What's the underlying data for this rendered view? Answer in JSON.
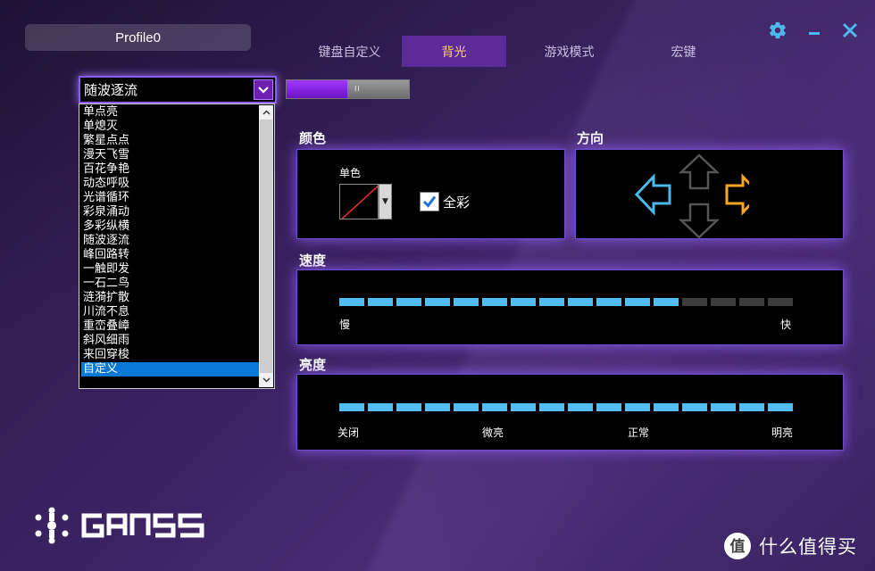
{
  "profile": {
    "name": "Profile0"
  },
  "tabs": [
    {
      "label": "键盘自定义",
      "active": false
    },
    {
      "label": "背光",
      "active": true
    },
    {
      "label": "游戏模式",
      "active": false
    },
    {
      "label": "宏键",
      "active": false
    }
  ],
  "window": {
    "settings_icon": "gear-icon",
    "minimize_icon": "minimize-icon",
    "close_icon": "close-icon"
  },
  "effect": {
    "selected": "随波逐流",
    "options": [
      "单点亮",
      "单熄灭",
      "繁星点点",
      "漫天飞雪",
      "百花争艳",
      "动态呼吸",
      "光谱循环",
      "彩泉涌动",
      "多彩纵横",
      "随波逐流",
      "峰回路转",
      "一触即发",
      "一石二鸟",
      "涟漪扩散",
      "川流不息",
      "重峦叠嶂",
      "斜风细雨",
      "来回穿梭",
      "自定义"
    ],
    "highlighted": "自定义"
  },
  "toggle": {
    "state": "on",
    "grip": "II"
  },
  "color": {
    "title": "颜色",
    "mono_label": "单色",
    "full_color_label": "全彩",
    "full_color_checked": true
  },
  "direction": {
    "title": "方向",
    "active": "right",
    "colors": {
      "left": "#4fb8ea",
      "right": "#f5a623",
      "inactive": "#555555"
    }
  },
  "speed": {
    "title": "速度",
    "level": 12,
    "max": 16,
    "min_label": "慢",
    "max_label": "快"
  },
  "brightness": {
    "title": "亮度",
    "level": 16,
    "max": 16,
    "labels": [
      "关闭",
      "微亮",
      "正常",
      "明亮"
    ]
  },
  "brand": {
    "logo_text": "GANSS"
  },
  "watermark": {
    "text": "什么值得买"
  },
  "colors": {
    "accent": "#8b5cf6",
    "segment_on": "#52bdf4",
    "segment_off": "#3c3c3c",
    "active_tab": "#5d2a9a",
    "active_tab_text": "#ffd45a"
  }
}
